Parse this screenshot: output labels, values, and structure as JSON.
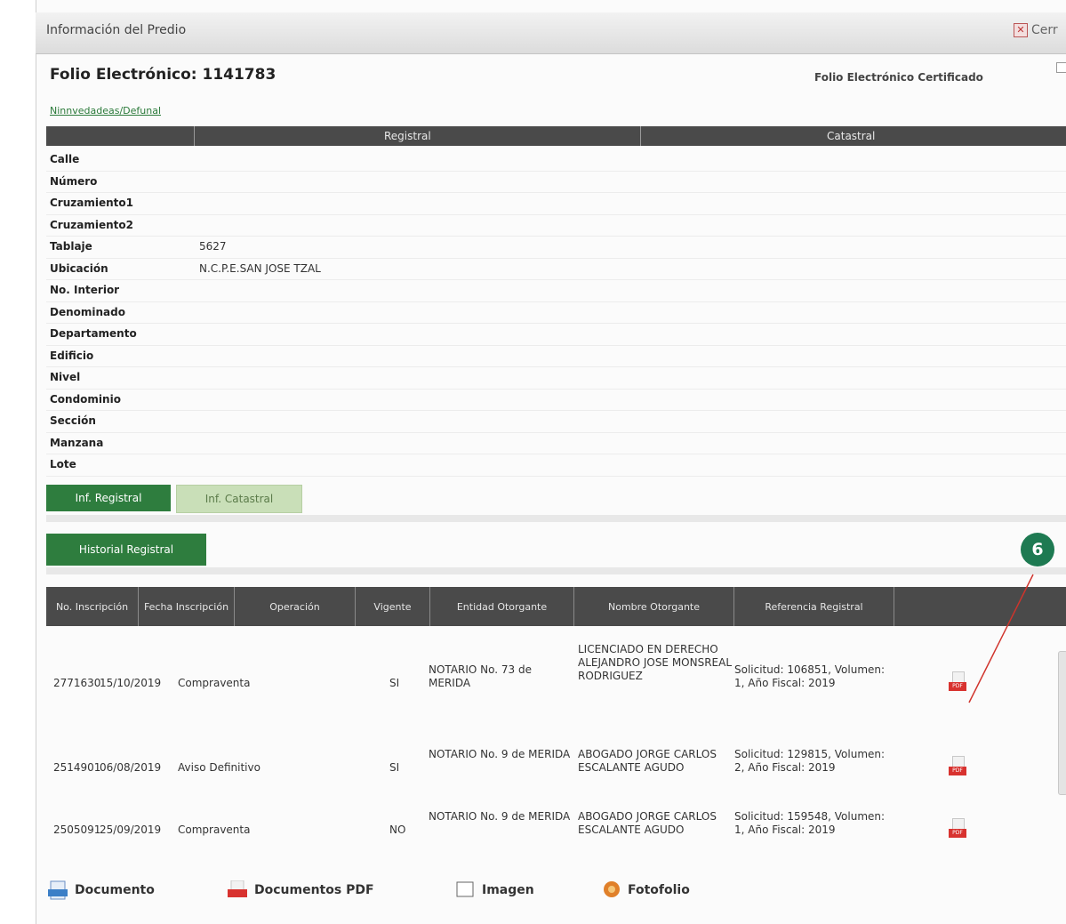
{
  "window": {
    "title": "Información del Predio",
    "close_label": "Cerr"
  },
  "header": {
    "folio_label": "Folio Electrónico: 1141783",
    "certified_label": "Folio Electrónico Certificado",
    "link_label": "Ninnvedadeas/Defunal"
  },
  "columns": {
    "left": "Registral",
    "right": "Catastral"
  },
  "properties": [
    {
      "label": "Calle",
      "value": ""
    },
    {
      "label": "Número",
      "value": ""
    },
    {
      "label": "Cruzamiento1",
      "value": ""
    },
    {
      "label": "Cruzamiento2",
      "value": ""
    },
    {
      "label": "Tablaje",
      "value": "5627"
    },
    {
      "label": "Ubicación",
      "value": "N.C.P.E.SAN JOSE TZAL"
    },
    {
      "label": "No. Interior",
      "value": ""
    },
    {
      "label": "Denominado",
      "value": ""
    },
    {
      "label": "Departamento",
      "value": ""
    },
    {
      "label": "Edificio",
      "value": ""
    },
    {
      "label": "Nivel",
      "value": ""
    },
    {
      "label": "Condominio",
      "value": ""
    },
    {
      "label": "Sección",
      "value": ""
    },
    {
      "label": "Manzana",
      "value": ""
    },
    {
      "label": "Lote",
      "value": ""
    }
  ],
  "tabs": {
    "registral": "Inf. Registral",
    "catastral": "Inf. Catastral"
  },
  "buttons": {
    "historial": "Historial Registral"
  },
  "table": {
    "headers": [
      "No. Inscripción",
      "Fecha Inscripción",
      "Operación",
      "Vigente",
      "Entidad Otorgante",
      "Nombre Otorgante",
      "Referencia Registral"
    ],
    "rows": [
      {
        "no": "2771630",
        "date": "15/10/2019",
        "op": "Compraventa",
        "vig": "SI",
        "entidad": "NOTARIO No. 73 de MERIDA",
        "nombre": "LICENCIADO EN DERECHO ALEJANDRO JOSE MONSREAL RODRIGUEZ",
        "ref": "Solicitud: 106851, Volumen: 1, Año Fiscal: 2019"
      },
      {
        "no": "2514901",
        "date": "06/08/2019",
        "op": "Aviso Definitivo",
        "vig": "SI",
        "entidad": "NOTARIO No. 9 de MERIDA",
        "nombre": "ABOGADO JORGE CARLOS ESCALANTE AGUDO",
        "ref": "Solicitud: 129815, Volumen: 2, Año Fiscal: 2019"
      },
      {
        "no": "2505091",
        "date": "25/09/2019",
        "op": "Compraventa",
        "vig": "NO",
        "entidad": "NOTARIO No. 9 de MERIDA",
        "nombre": "ABOGADO JORGE CARLOS ESCALANTE AGUDO",
        "ref": "Solicitud: 159548, Volumen: 1, Año Fiscal: 2019"
      }
    ]
  },
  "annotation": {
    "badge": "6",
    "color": "#1e7a52"
  },
  "footer": {
    "documento": "Documento",
    "pdf": "Documentos PDF",
    "imagen": "Imagen",
    "fotos": "Fotofolio"
  }
}
